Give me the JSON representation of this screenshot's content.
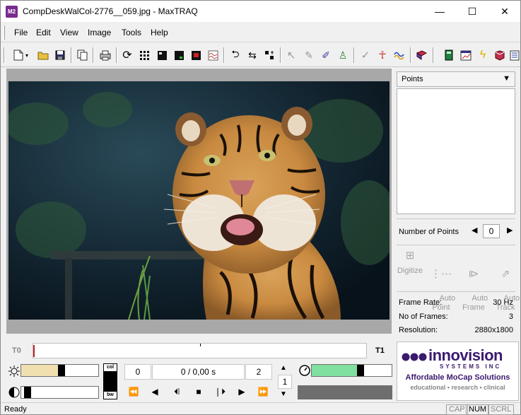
{
  "window": {
    "icon_text": "M2",
    "title": "CompDeskWalCol-2776__059.jpg - MaxTRAQ",
    "min_glyph": "—",
    "max_glyph": "☐",
    "close_glyph": "✕"
  },
  "menu": [
    "File",
    "Edit",
    "View",
    "Image",
    "Tools",
    "Help"
  ],
  "toolbar": {
    "icons": [
      "new-file-icon",
      "open-folder-icon",
      "save-icon",
      "copy-icon",
      "print-icon",
      "refresh-icon",
      "grid-icon",
      "frame-icon",
      "frame-green-icon",
      "frame-red-icon",
      "wave-icon",
      "rotate-icon",
      "swap-icon",
      "crosshair-icon",
      "cursor-icon",
      "pointer-icon",
      "pencil-icon",
      "person-stand-icon",
      "check-icon",
      "stick-figure-icon",
      "graph-icon",
      "book-icon",
      "calculator-icon",
      "chart-icon",
      "lightning-icon",
      "export-icon",
      "list-icon"
    ]
  },
  "right_panel": {
    "dropdown_value": "Points",
    "number_of_points_label": "Number of Points",
    "number_of_points": "0",
    "buttons": [
      {
        "label": "Digitize",
        "icon": "digitize-icon"
      },
      {
        "label": "Auto\nPoint",
        "icon": "auto-point-icon"
      },
      {
        "label": "Auto\nFrame",
        "icon": "auto-frame-icon"
      },
      {
        "label": "Auto\nTrack",
        "icon": "auto-track-icon"
      }
    ],
    "frame_rate_label": "Frame Rate:",
    "frame_rate": "30 Hz",
    "frames_label": "No of Frames:",
    "frames": "3",
    "resolution_label": "Resolution:",
    "resolution": "2880x1800"
  },
  "timeline": {
    "start_label": "T0",
    "end_label": "T1"
  },
  "controls": {
    "brightness_level": 0.48,
    "contrast_level": 0.04,
    "col_label": "col",
    "bw_label": "bw",
    "frame_start": "0",
    "frame_current": "0 /  0,00 s",
    "frame_end": "2",
    "step": "1",
    "speed_level": 0.57,
    "brightness_color": "#f0e0b0",
    "speed_color": "#80e0a0"
  },
  "logo": {
    "brand": "innovision",
    "systems": "SYSTEMS INC",
    "tagline": "Affordable MoCap Solutions",
    "subline": "educational • research • clinical"
  },
  "status": {
    "text": "Ready",
    "cap": "CAP",
    "num": "NUM",
    "scrl": "SCRL"
  }
}
